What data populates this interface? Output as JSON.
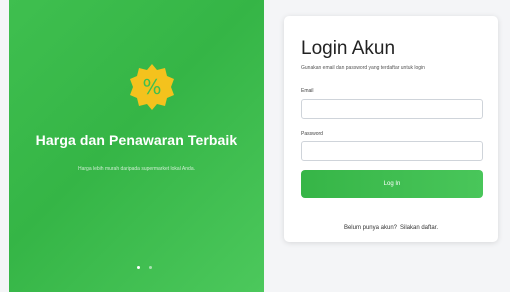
{
  "promo": {
    "badge_symbol": "%",
    "title": "Harga dan Penawaran Terbaik",
    "subtitle": "Harga lebih murah daripada supermarket lokal Anda.",
    "colors": {
      "panel": "#3fbf4f",
      "badge": "#f4c21d"
    }
  },
  "login": {
    "title": "Login Akun",
    "subtitle": "Gunakan email dan password yang terdaftar untuk login",
    "email_label": "Email",
    "email_value": "",
    "password_label": "Password",
    "password_value": "",
    "button_label": "Log In",
    "register_prompt": "Belum punya akun?",
    "register_link": "Silakan daftar.",
    "colors": {
      "button": "#36b547"
    }
  },
  "carousel": {
    "dot_count": 2,
    "active_index": 0
  }
}
